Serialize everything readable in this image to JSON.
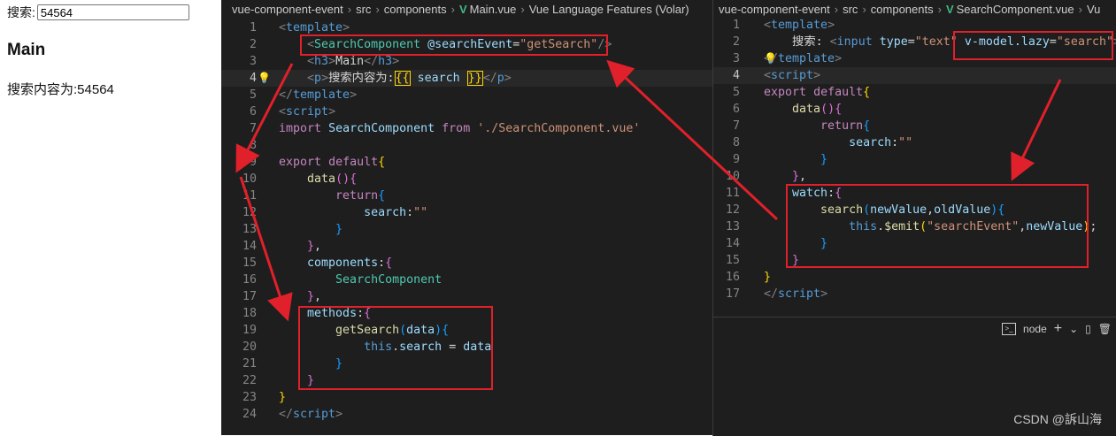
{
  "preview": {
    "search_label": "搜索:",
    "search_value": "54564",
    "heading": "Main",
    "result_text": "搜索内容为:54564"
  },
  "main_editor": {
    "breadcrumb": [
      "vue-component-event",
      "src",
      "components",
      "Main.vue",
      "Vue Language Features (Volar)"
    ],
    "active_line": 4
  },
  "search_editor": {
    "breadcrumb": [
      "vue-component-event",
      "src",
      "components",
      "SearchComponent.vue",
      "Vu"
    ],
    "active_line": 4
  },
  "terminal": {
    "label": "node"
  },
  "watermark": "CSDN @訴山海",
  "colors": {
    "highlight_red": "#e0202a",
    "editor_bg": "#1e1e1e",
    "vue_green": "#41b883"
  },
  "icons": {
    "vue": "vue-logo-icon",
    "terminal": "terminal-icon",
    "plus": "plus-icon",
    "chevron": "chevron-down-icon",
    "split": "split-icon",
    "trash": "trash-icon",
    "bulb": "lightbulb-icon"
  }
}
